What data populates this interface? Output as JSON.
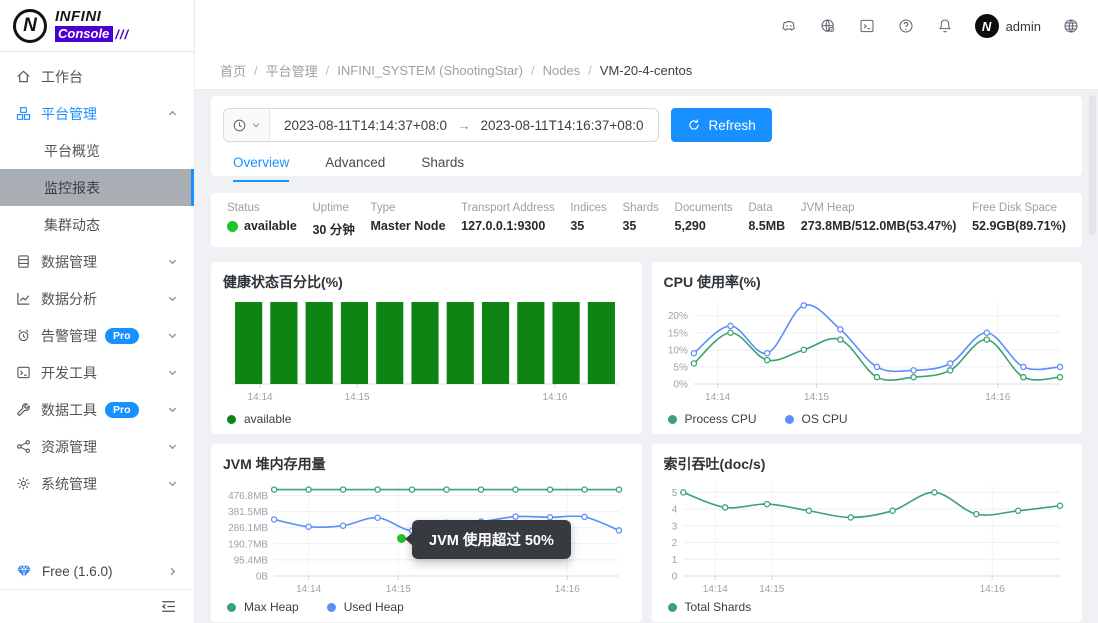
{
  "header": {
    "user": "admin",
    "accent": "#1890ff",
    "icons": [
      "discord-icon",
      "website-icon",
      "console-icon",
      "help-icon",
      "bell-icon",
      "language-icon"
    ],
    "logo": {
      "circle_letter": "N",
      "brand_top": "INFINI",
      "brand_bottom": "Console",
      "slashes": "///",
      "purple": "#4b00d2"
    }
  },
  "sidebar": {
    "items": [
      {
        "name": "workbench",
        "label": "工作台",
        "icon": "home"
      },
      {
        "name": "platform-management",
        "label": "平台管理",
        "icon": "platform",
        "active": true,
        "expanded": true,
        "children": [
          {
            "name": "platform-overview",
            "label": "平台概览"
          },
          {
            "name": "monitor-reports",
            "label": "监控报表",
            "selected": true
          },
          {
            "name": "cluster-activities",
            "label": "集群动态"
          }
        ]
      },
      {
        "name": "data-management",
        "label": "数据管理",
        "icon": "database",
        "collapsible": true
      },
      {
        "name": "data-analysis",
        "label": "数据分析",
        "icon": "analytics",
        "collapsible": true
      },
      {
        "name": "alerting-management",
        "label": "告警管理",
        "icon": "alarm",
        "badge": "Pro",
        "collapsible": true
      },
      {
        "name": "dev-tools",
        "label": "开发工具",
        "icon": "terminal",
        "collapsible": true
      },
      {
        "name": "data-tools",
        "label": "数据工具",
        "icon": "wrench",
        "badge": "Pro",
        "collapsible": true
      },
      {
        "name": "resource-management",
        "label": "资源管理",
        "icon": "share",
        "collapsible": true
      },
      {
        "name": "system-management",
        "label": "系统管理",
        "icon": "gear",
        "collapsible": true
      }
    ],
    "footer": {
      "label": "Free (1.6.0)"
    }
  },
  "breadcrumb": {
    "separator": "/",
    "items": [
      "首页",
      "平台管理",
      "INFINI_SYSTEM (ShootingStar)",
      "Nodes",
      "VM-20-4-centos"
    ]
  },
  "toolbar": {
    "time_from": "2023-08-11T14:14:37+08:0",
    "arrow": "→",
    "time_to": "2023-08-11T14:16:37+08:0",
    "refresh_label": "Refresh"
  },
  "tabs": [
    {
      "label": "Overview",
      "active": true
    },
    {
      "label": "Advanced",
      "active": false
    },
    {
      "label": "Shards",
      "active": false
    }
  ],
  "stats": [
    {
      "label": "Status",
      "value": "available",
      "dot": "#1ec428"
    },
    {
      "label": "Uptime",
      "value": "30 分钟"
    },
    {
      "label": "Type",
      "value": "Master Node"
    },
    {
      "label": "Transport Address",
      "value": "127.0.0.1:9300"
    },
    {
      "label": "Indices",
      "value": "35"
    },
    {
      "label": "Shards",
      "value": "35"
    },
    {
      "label": "Documents",
      "value": "5,290"
    },
    {
      "label": "Data",
      "value": "8.5MB"
    },
    {
      "label": "JVM Heap",
      "value": "273.8MB/512.0MB(53.47%)"
    },
    {
      "label": "Free Disk Space",
      "value": "52.9GB(89.71%)"
    }
  ],
  "charts": [
    {
      "name": "health-percentage",
      "title": "健康状态百分比(%)",
      "chart_data": {
        "type": "bar",
        "values": [
          100,
          100,
          100,
          100,
          100,
          100,
          100,
          100,
          100,
          100,
          100
        ],
        "ylim": [
          0,
          100
        ],
        "color": "#0e8412",
        "x_ticks": [
          {
            "label": "14:14",
            "pos": 0.075
          },
          {
            "label": "14:15",
            "pos": 0.325
          },
          {
            "label": "14:16",
            "pos": 0.835
          }
        ],
        "legend": [
          {
            "label": "available",
            "color": "#0e8412"
          }
        ]
      }
    },
    {
      "name": "cpu-usage",
      "title": "CPU 使用率(%)",
      "chart_data": {
        "type": "line",
        "ylim": [
          0,
          24
        ],
        "y_ticks": [
          {
            "v": 0,
            "label": "0%"
          },
          {
            "v": 5,
            "label": "5%"
          },
          {
            "v": 10,
            "label": "10%"
          },
          {
            "v": 15,
            "label": "15%"
          },
          {
            "v": 20,
            "label": "20%"
          }
        ],
        "x_ticks": [
          {
            "label": "14:14",
            "pos": 0.065
          },
          {
            "label": "14:15",
            "pos": 0.335
          },
          {
            "label": "14:16",
            "pos": 0.83
          }
        ],
        "series": [
          {
            "name": "Process CPU",
            "color": "#3ba272",
            "values": [
              6,
              15,
              7,
              10,
              13,
              2,
              2,
              4,
              13,
              2,
              2
            ]
          },
          {
            "name": "OS CPU",
            "color": "#5b8ff9",
            "values": [
              9,
              17,
              9,
              23,
              16,
              5,
              4,
              6,
              15,
              5,
              5
            ]
          }
        ]
      }
    },
    {
      "name": "jvm-heap-usage",
      "title": "JVM 堆内存用量",
      "chart_data": {
        "type": "line",
        "ylim": [
          0,
          545
        ],
        "y_ticks": [
          {
            "v": 0,
            "label": "0B"
          },
          {
            "v": 95.4,
            "label": "95.4MB"
          },
          {
            "v": 190.7,
            "label": "190.7MB"
          },
          {
            "v": 286.1,
            "label": "286.1MB"
          },
          {
            "v": 381.5,
            "label": "381.5MB"
          },
          {
            "v": 476.8,
            "label": "476.8MB"
          }
        ],
        "x_ticks": [
          {
            "label": "14:14",
            "pos": 0.1
          },
          {
            "label": "14:15",
            "pos": 0.36
          },
          {
            "label": "14:16",
            "pos": 0.85
          }
        ],
        "series": [
          {
            "name": "Max Heap",
            "color": "#3ba272",
            "values": [
              512,
              512,
              512,
              512,
              512,
              512,
              512,
              512,
              512,
              512,
              512
            ]
          },
          {
            "name": "Used Heap",
            "color": "#5b8ff9",
            "values": [
              335,
              292,
              298,
              345,
              268,
              315,
              322,
              352,
              348,
              350,
              270
            ]
          }
        ]
      },
      "tooltip": {
        "text": "JVM 使用超过 50%"
      }
    },
    {
      "name": "indexing-throughput",
      "title": "索引吞吐(doc/s)",
      "chart_data": {
        "type": "line",
        "ylim": [
          0,
          5.5
        ],
        "y_ticks": [
          {
            "v": 0,
            "label": "0"
          },
          {
            "v": 1,
            "label": "1"
          },
          {
            "v": 2,
            "label": "2"
          },
          {
            "v": 3,
            "label": "3"
          },
          {
            "v": 4,
            "label": "4"
          },
          {
            "v": 5,
            "label": "5"
          }
        ],
        "x_ticks": [
          {
            "label": "14:14",
            "pos": 0.085
          },
          {
            "label": "14:15",
            "pos": 0.235
          },
          {
            "label": "14:16",
            "pos": 0.82
          }
        ],
        "series": [
          {
            "name": "Total Shards",
            "color": "#3ba272",
            "values": [
              5,
              4.1,
              4.3,
              3.9,
              3.5,
              3.9,
              5,
              3.7,
              3.9,
              4.2
            ]
          }
        ]
      }
    }
  ]
}
